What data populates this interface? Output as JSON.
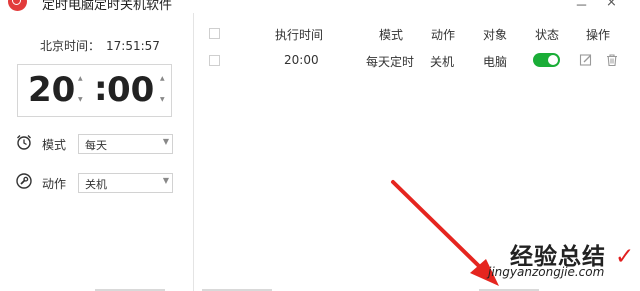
{
  "window": {
    "title": "定时电脑定时关机软件",
    "minimize_label": "－",
    "close_label": "×"
  },
  "clock": {
    "label": "北京时间：",
    "time": "17:51:57"
  },
  "timer": {
    "hours": "20",
    "minutes": "00"
  },
  "options": {
    "mode_label": "模式",
    "mode_value": "每天",
    "action_label": "动作",
    "action_value": "关机"
  },
  "table": {
    "headers": {
      "time": "执行时间",
      "mode": "模式",
      "action": "动作",
      "target": "对象",
      "status": "状态",
      "ops": "操作"
    },
    "rows": [
      {
        "time": "20:00",
        "mode": "每天定时",
        "action": "关机",
        "target": "电脑",
        "enabled": true
      }
    ]
  },
  "watermark": {
    "title": "经验总结",
    "url": "jingyanzongjie.com"
  },
  "colors": {
    "toggle_on": "#1aad37",
    "arrow": "#e5251f",
    "logo": "#e23b3b"
  }
}
